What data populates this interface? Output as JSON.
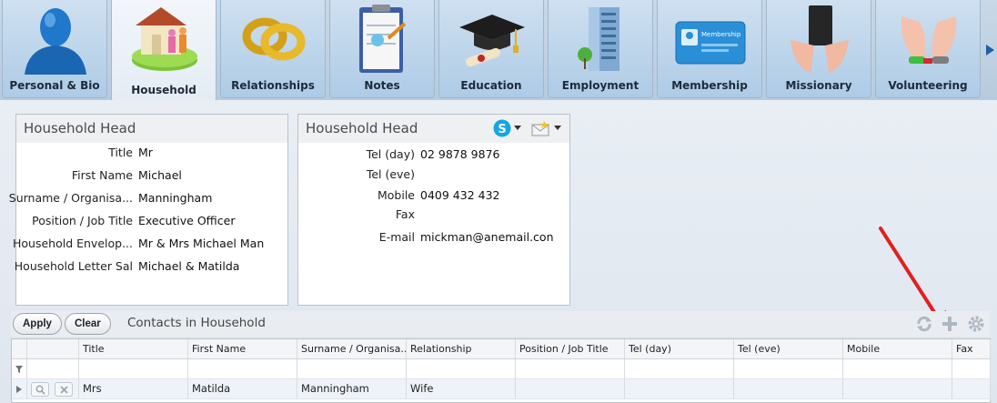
{
  "tabs": [
    {
      "label": "Personal & Bio",
      "icon": "person-icon",
      "active": false
    },
    {
      "label": "Household",
      "icon": "house-icon",
      "active": true
    },
    {
      "label": "Relationships",
      "icon": "rings-icon",
      "active": false
    },
    {
      "label": "Notes",
      "icon": "clipboard-icon",
      "active": false
    },
    {
      "label": "Education",
      "icon": "graduation-cap-icon",
      "active": false
    },
    {
      "label": "Employment",
      "icon": "office-building-icon",
      "active": false
    },
    {
      "label": "Membership",
      "icon": "membership-card-icon",
      "active": false
    },
    {
      "label": "Missionary",
      "icon": "bible-hands-icon",
      "active": false
    },
    {
      "label": "Volunteering",
      "icon": "raised-hands-icon",
      "active": false
    }
  ],
  "membership_card_text": "Membership",
  "household_panel": {
    "title": "Household Head",
    "fields": [
      {
        "label": "Title",
        "value": "Mr"
      },
      {
        "label": "First Name",
        "value": "Michael"
      },
      {
        "label": "Surname / Organisa...",
        "value": "Manningham"
      },
      {
        "label": "Position / Job Title",
        "value": "Executive Officer"
      },
      {
        "label": "Household Envelop...",
        "value": "Mr & Mrs Michael Man"
      },
      {
        "label": "Household Letter Sal",
        "value": "Michael & Matilda"
      }
    ]
  },
  "contact_panel": {
    "title": "Household Head",
    "fields": [
      {
        "label": "Tel (day)",
        "value": "02 9878 9876"
      },
      {
        "label": "Tel (eve)",
        "value": ""
      },
      {
        "label": "Mobile",
        "value": "0409 432 432"
      },
      {
        "label": "Fax",
        "value": ""
      },
      {
        "label": "E-mail",
        "value": "mickman@anemail.con"
      }
    ]
  },
  "toolbar": {
    "apply_label": "Apply",
    "clear_label": "Clear",
    "title": "Contacts in Household"
  },
  "grid": {
    "columns": [
      "Title",
      "First Name",
      "Surname / Organisa...",
      "Relationship",
      "Position / Job Title",
      "Tel (day)",
      "Tel (eve)",
      "Mobile",
      "Fax"
    ],
    "rows": [
      [
        "Mrs",
        "Matilda",
        "Manningham",
        "Wife",
        "",
        "",
        "",
        "",
        ""
      ]
    ]
  },
  "colors": {
    "accent_red": "#e02020",
    "skype_blue": "#12a5e8"
  }
}
